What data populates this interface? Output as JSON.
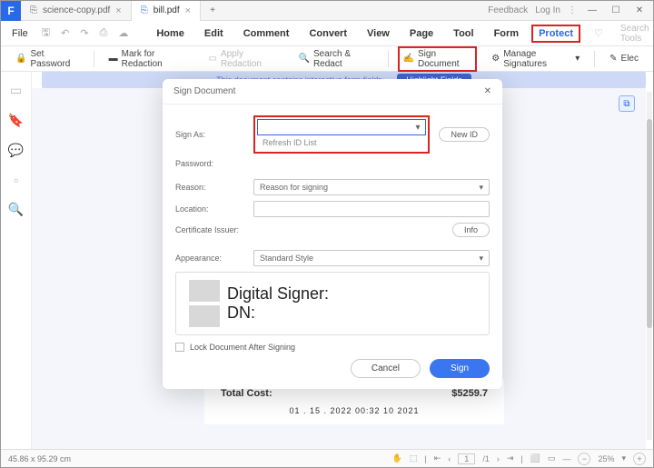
{
  "titlebar": {
    "tabs": [
      {
        "label": "science-copy.pdf"
      },
      {
        "label": "bill.pdf"
      }
    ],
    "add": "+",
    "right": {
      "feedback": "Feedback",
      "login": "Log In"
    }
  },
  "menubar": {
    "file": "File",
    "items": [
      "Home",
      "Edit",
      "Comment",
      "Convert",
      "View",
      "Page",
      "Tool",
      "Form",
      "Protect"
    ],
    "search_placeholder": "Search Tools"
  },
  "toolbar": {
    "set_password": "Set Password",
    "mark_redaction": "Mark for Redaction",
    "apply_redaction": "Apply Redaction",
    "search_redact": "Search & Redact",
    "sign_document": "Sign Document",
    "manage_signatures": "Manage Signatures",
    "elec": "Elec"
  },
  "banner": {
    "msg": "This document contains interactive form fields.",
    "btn": "Highlight Fields"
  },
  "dialog": {
    "title": "Sign Document",
    "labels": {
      "sign_as": "Sign As:",
      "password": "Password:",
      "reason": "Reason:",
      "location": "Location:",
      "cert": "Certificate Issuer:",
      "appearance": "Appearance:"
    },
    "refresh": "Refresh ID List",
    "new_id": "New ID",
    "reason_ph": "Reason for signing",
    "info": "Info",
    "appearance_val": "Standard Style",
    "preview": {
      "line1": "Digital Signer:",
      "line2": "DN:"
    },
    "lock": "Lock Document After Signing",
    "cancel": "Cancel",
    "sign": "Sign"
  },
  "doc": {
    "total_label": "Total Cost:",
    "total_val": "$5259.7",
    "date": "01 . 15 . 2022  00:32  10 2021"
  },
  "status": {
    "dim": "45.86 x 95.29 cm",
    "page": "1",
    "pages": "/1",
    "zoom": "25%"
  }
}
